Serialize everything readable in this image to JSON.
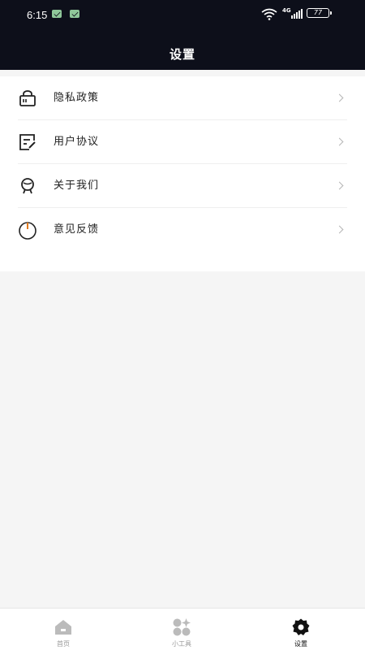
{
  "status_bar": {
    "time": "6:15",
    "network": "4G",
    "battery": "77"
  },
  "header": {
    "title": "设置"
  },
  "menu": [
    {
      "label": "隐私政策",
      "icon": "lock-icon"
    },
    {
      "label": "用户协议",
      "icon": "document-edit-icon"
    },
    {
      "label": "关于我们",
      "icon": "user-face-icon"
    },
    {
      "label": "意见反馈",
      "icon": "power-icon"
    }
  ],
  "tabbar": {
    "items": [
      {
        "label": "首页",
        "icon": "home-icon",
        "active": false
      },
      {
        "label": "小工具",
        "icon": "tools-icon",
        "active": false
      },
      {
        "label": "设置",
        "icon": "gear-icon",
        "active": true
      }
    ]
  },
  "colors": {
    "header_bg": "#0d0f1a",
    "page_bg": "#f5f5f5",
    "active_tab": "#111111",
    "inactive_tab": "#bbbbbb"
  }
}
